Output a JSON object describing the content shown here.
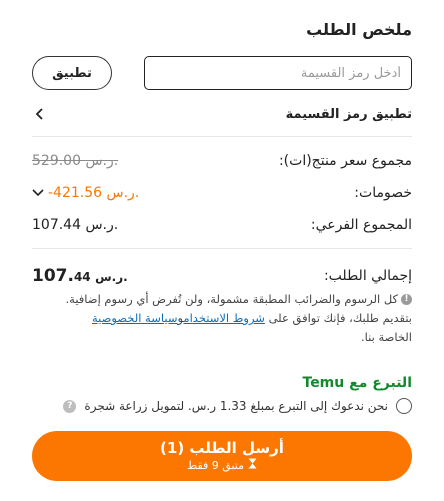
{
  "summary": {
    "title": "ملخص الطلب"
  },
  "coupon": {
    "placeholder": "أدخل رمز القسيمة",
    "apply_label": "تطبيق",
    "row_label": "تطبيق رمز القسيمة"
  },
  "totals": {
    "items_label": "مجموع سعر منتج(ات):",
    "items_value": "529.00 ر.س.",
    "discount_label": "خصومات:",
    "discount_value": "-421.56 ر.س.",
    "subtotal_label": "المجموع الفرعي:",
    "subtotal_value": "107.44 ر.س.",
    "total_label": "إجمالي الطلب:",
    "total_big": "107.",
    "total_small": "44",
    "total_currency": "ر.س."
  },
  "note": {
    "line1": "كل الرسوم والضرائب المطبقة مشمولة، ولن تُفرض أي رسوم إضافية.",
    "line2_prefix": "بتقديم طلبك، فإنك توافق على",
    "terms_link": "شروط الاستخدام",
    "and": "و",
    "privacy_link": "سياسة الخصوصية",
    "line3": "الخاصة بنا."
  },
  "donation": {
    "title": "التبرع مع Temu",
    "text": "نحن ندعوك إلى التبرع بمبلغ 1.33 ر.س. لتمويل زراعة شجرة"
  },
  "submit": {
    "label": "أرسل الطلب (1)",
    "sublabel": "متبق 9 فقط"
  },
  "colors": {
    "accent": "#fb7701",
    "donate_green": "#118a2e",
    "link_blue": "#0a6ebd"
  },
  "icons": [
    "chevron-left-icon",
    "chevron-down-icon",
    "info-icon",
    "question-icon",
    "hourglass-icon"
  ]
}
